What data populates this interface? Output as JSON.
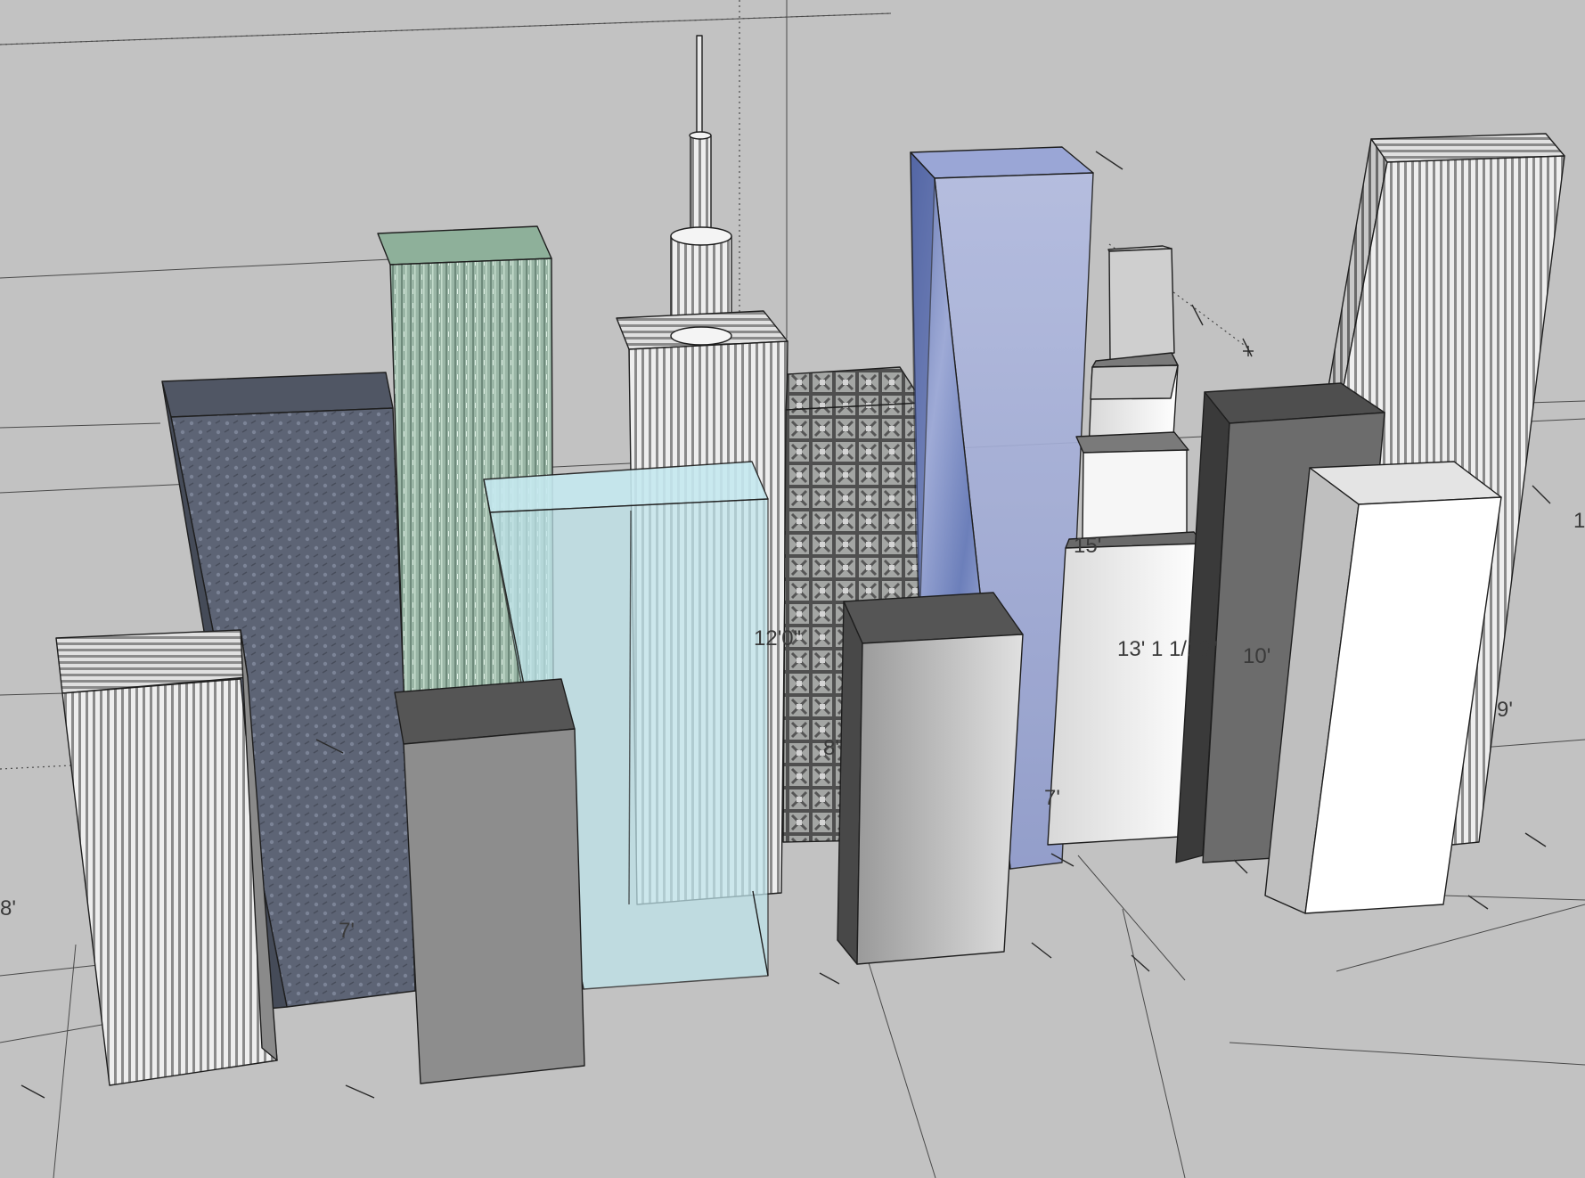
{
  "dimensions": {
    "left_building_height": "8'",
    "dark_tower_height": "7'",
    "grid_tower_height": "12'0\"",
    "grid_tower_base": "8'",
    "stepped_tower_top": "15'",
    "stepped_tower_height": "13' 1 1/16\"",
    "glass_tower_base": "7'",
    "charcoal_tower_height": "10'",
    "white_tower_height": "9'",
    "far_right_height": "1"
  },
  "materials": {
    "ground": "#c2c2c2",
    "navy_texture": "#5c6373",
    "green_texture": "#8fa89a",
    "ice_glass": "#bfe5ec",
    "sky_glass": "#7889c0",
    "grey_solid": "#8c8c8c",
    "charcoal": "#545454",
    "white": "#ffffff"
  }
}
